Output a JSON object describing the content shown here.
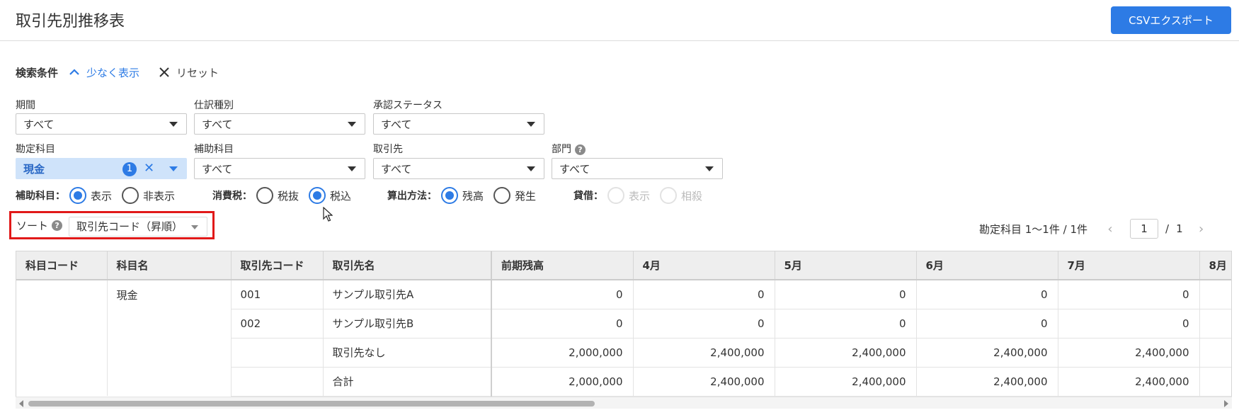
{
  "header": {
    "title": "取引先別推移表",
    "csv_button": "CSVエクスポート"
  },
  "search": {
    "label": "検索条件",
    "toggle_label": "少なく表示",
    "reset_label": "リセット"
  },
  "filters": {
    "period": {
      "label": "期間",
      "value": "すべて"
    },
    "journal_type": {
      "label": "仕訳種別",
      "value": "すべて"
    },
    "approval": {
      "label": "承認ステータス",
      "value": "すべて"
    },
    "account": {
      "label": "勘定科目",
      "value": "現金",
      "count": "1"
    },
    "sub_account": {
      "label": "補助科目",
      "value": "すべて"
    },
    "partner": {
      "label": "取引先",
      "value": "すべて"
    },
    "department": {
      "label": "部門",
      "value": "すべて"
    }
  },
  "radios": {
    "sub_account": {
      "label": "補助科目：",
      "options": [
        "表示",
        "非表示"
      ],
      "selected": "表示"
    },
    "tax": {
      "label": "消費税：",
      "options": [
        "税抜",
        "税込"
      ],
      "selected": "税込"
    },
    "method": {
      "label": "算出方法：",
      "options": [
        "残高",
        "発生"
      ],
      "selected": "残高"
    },
    "debit_credit": {
      "label": "貸借：",
      "options": [
        "表示",
        "相殺"
      ],
      "selected": ""
    }
  },
  "sort": {
    "label": "ソート",
    "value": "取引先コード（昇順）"
  },
  "pager": {
    "summary": "勘定科目 1〜1件 / 1件",
    "page": "1",
    "sep": "/",
    "total": "1",
    "prev": "‹",
    "next": "›"
  },
  "table": {
    "columns": [
      "科目コード",
      "科目名",
      "取引先コード",
      "取引先名",
      "前期残高",
      "4月",
      "5月",
      "6月",
      "7月",
      "8月"
    ],
    "rows": [
      [
        "",
        "現金",
        "001",
        "サンプル取引先A",
        "0",
        "0",
        "0",
        "0",
        "0",
        ""
      ],
      [
        "",
        "",
        "002",
        "サンプル取引先B",
        "0",
        "0",
        "0",
        "0",
        "0",
        ""
      ],
      [
        "",
        "",
        "",
        "取引先なし",
        "2,000,000",
        "2,400,000",
        "2,400,000",
        "2,400,000",
        "2,400,000",
        ""
      ],
      [
        "",
        "",
        "",
        "合計",
        "2,000,000",
        "2,400,000",
        "2,400,000",
        "2,400,000",
        "2,400,000",
        ""
      ]
    ]
  },
  "icons": {
    "help": "?",
    "clear": "✕"
  },
  "colors": {
    "accent": "#2d7be5",
    "highlight": "#e11919",
    "chip_bg": "#cfe3fa"
  }
}
